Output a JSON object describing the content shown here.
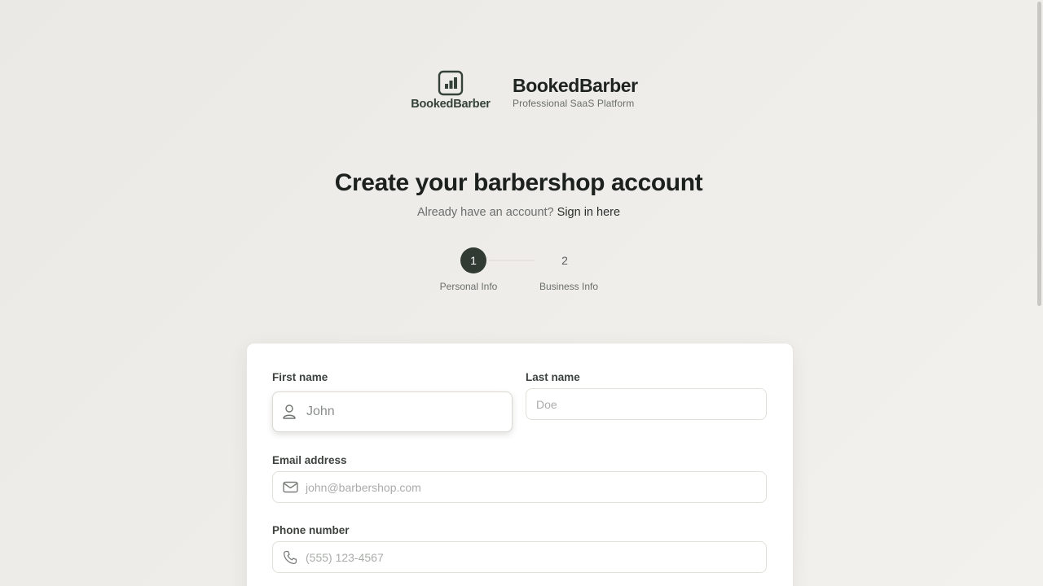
{
  "brand": {
    "logo_wordmark": "BookedBarber",
    "name": "BookedBarber",
    "tagline": "Professional SaaS Platform"
  },
  "page": {
    "title": "Create your barbershop account",
    "signin_prompt": "Already have an account?",
    "signin_link": "Sign in here"
  },
  "stepper": {
    "current_step": 1,
    "steps": [
      {
        "number": "1",
        "label": "Personal Info"
      },
      {
        "number": "2",
        "label": "Business Info"
      }
    ]
  },
  "form": {
    "first_name": {
      "label": "First name",
      "placeholder": "John",
      "value": "",
      "icon": "user-icon"
    },
    "last_name": {
      "label": "Last name",
      "placeholder": "Doe",
      "value": ""
    },
    "email": {
      "label": "Email address",
      "placeholder": "john@barbershop.com",
      "value": "",
      "icon": "mail-icon"
    },
    "phone": {
      "label": "Phone number",
      "placeholder": "(555) 123-4567",
      "value": "",
      "icon": "phone-icon"
    }
  },
  "colors": {
    "background": "#ecebe7",
    "primary": "#323a34",
    "logo": "#34423a",
    "text": "#1f231f",
    "muted": "#6a6e6a"
  }
}
